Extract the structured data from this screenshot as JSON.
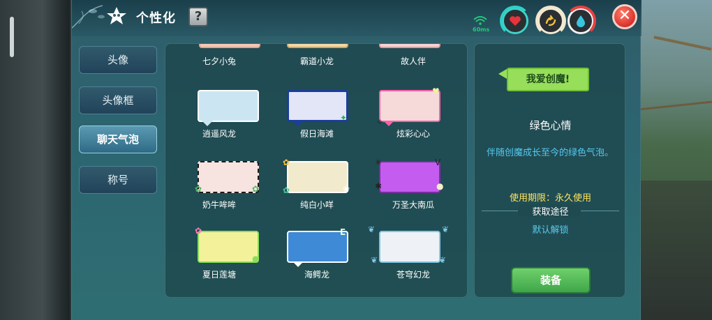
{
  "header": {
    "title": "个性化",
    "help_label": "?",
    "signal_label": "60ms",
    "close_label": "✕"
  },
  "hud": {
    "heart_icon": "heart-icon",
    "stamina_icon": "stamina-icon",
    "water_icon": "water-drop-icon"
  },
  "tabs": [
    {
      "label": "头像",
      "active": false
    },
    {
      "label": "头像框",
      "active": false
    },
    {
      "label": "聊天气泡",
      "active": true
    },
    {
      "label": "称号",
      "active": false
    }
  ],
  "bubbles": [
    {
      "label": "七夕小兔",
      "color": "#f2c9b6",
      "border": "#e7a58a",
      "row": "partial"
    },
    {
      "label": "霸道小龙",
      "color": "#f3d9a8",
      "border": "#d8a55a",
      "row": "partial"
    },
    {
      "label": "故人伴",
      "color": "#f6d3d3",
      "border": "#e39a9a",
      "row": "partial"
    },
    {
      "label": "逍遥风龙",
      "color": "#cbe6f2",
      "border": "#ffffff"
    },
    {
      "label": "假日海滩",
      "color": "#e2e6f6",
      "border": "#1a3d9e"
    },
    {
      "label": "炫彩心心",
      "color": "#f6dada",
      "border": "#ff5ea8"
    },
    {
      "label": "奶牛哞哞",
      "color": "#f7e3e0",
      "border": "#1b1b1b"
    },
    {
      "label": "纯白小咩",
      "color": "#f2eacc",
      "border": "#ffffff"
    },
    {
      "label": "万圣大南瓜",
      "color": "#c45cf0",
      "border": "#7a2fa0"
    },
    {
      "label": "夏日莲塘",
      "color": "#f3f29a",
      "border": "#8adf5a"
    },
    {
      "label": "海鳄龙",
      "color": "#3f8ad6",
      "border": "#ffffff"
    },
    {
      "label": "苍穹幻龙",
      "color": "#eef2f6",
      "border": "#7ec8e8"
    }
  ],
  "detail": {
    "preview_text": "我爱创魔!",
    "name": "绿色心情",
    "description": "伴随创魔成长至今的绿色气泡。",
    "period": "使用期限：永久使用",
    "source_label": "获取途径",
    "source_value": "默认解锁",
    "equip_label": "装备"
  }
}
